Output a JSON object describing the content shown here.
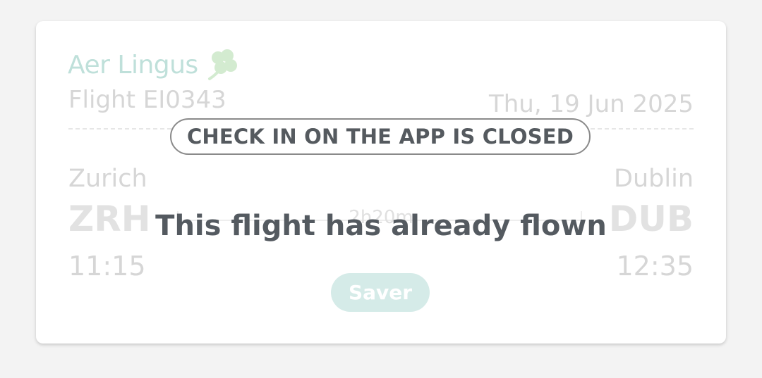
{
  "colors": {
    "brand_green": "#bfe0da",
    "fare_badge_bg": "#d5ebe8",
    "status_text": "#555a5f",
    "faded_text": "#d6d6d6"
  },
  "card": {
    "airline_name": "Aer Lingus",
    "airline_logo_icon": "shamrock-icon",
    "flight_label": "Flight EI0343",
    "date": "Thu, 19 Jun 2025",
    "status_pill": "CHECK IN ON THE APP IS CLOSED",
    "origin": {
      "city": "Zurich",
      "code": "ZRH",
      "time": "11:15"
    },
    "destination": {
      "city": "Dublin",
      "code": "DUB",
      "time": "12:35"
    },
    "duration": "2h20m",
    "message": "This flight has already flown",
    "fare_type": "Saver"
  }
}
